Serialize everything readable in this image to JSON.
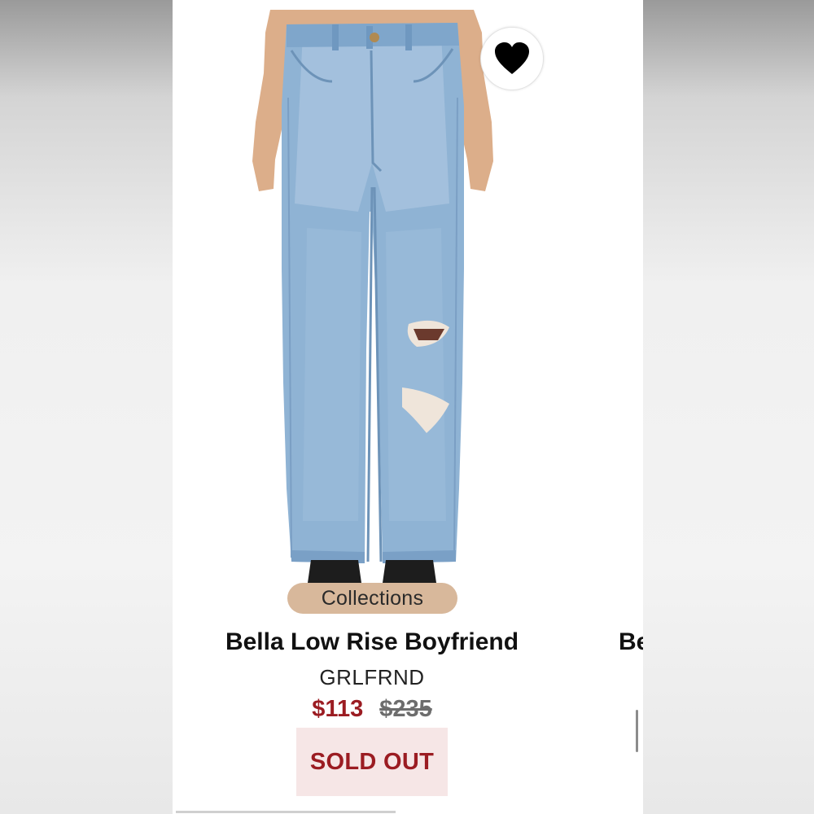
{
  "product": {
    "collection_badge": "Collections",
    "name": "Bella Low Rise Boyfriend",
    "brand": "GRLFRND",
    "sale_price": "$113",
    "original_price": "$235",
    "status_button": "SOLD OUT"
  },
  "next_product": {
    "name_partial": "Be"
  },
  "icons": {
    "favorite": "heart-icon"
  },
  "colors": {
    "sale_price": "#9b1c22",
    "sold_out_bg": "#f6e6e6",
    "badge_bg": "#d8b89b"
  }
}
